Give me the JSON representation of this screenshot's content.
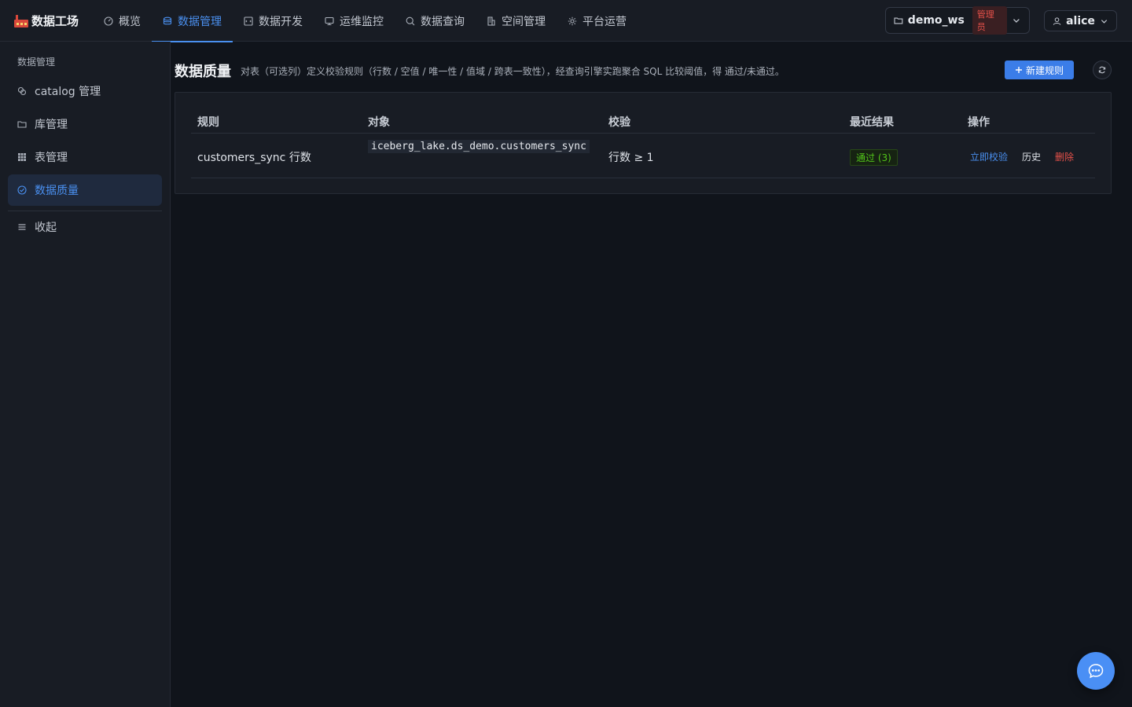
{
  "brand": {
    "title": "数据工场"
  },
  "nav": {
    "items": [
      {
        "label": "概览",
        "icon": "dashboard-icon"
      },
      {
        "label": "数据管理",
        "icon": "database-icon",
        "active": true
      },
      {
        "label": "数据开发",
        "icon": "code-icon"
      },
      {
        "label": "运维监控",
        "icon": "monitor-icon"
      },
      {
        "label": "数据查询",
        "icon": "search-icon"
      },
      {
        "label": "空间管理",
        "icon": "building-icon"
      },
      {
        "label": "平台运营",
        "icon": "gear-icon"
      }
    ]
  },
  "workspace": {
    "name": "demo_ws",
    "role": "管理员"
  },
  "user": {
    "name": "alice"
  },
  "sidebar": {
    "title": "数据管理",
    "items": [
      {
        "label": "catalog 管理",
        "icon": "link-icon"
      },
      {
        "label": "库管理",
        "icon": "folder-icon"
      },
      {
        "label": "表管理",
        "icon": "table-icon"
      },
      {
        "label": "数据质量",
        "icon": "check-circle-icon",
        "active": true
      }
    ],
    "collapse_label": "收起"
  },
  "page": {
    "title": "数据质量",
    "description": "对表（可选列）定义校验规则（行数 / 空值 / 唯一性 / 值域 / 跨表一致性），经查询引擎实跑聚合 SQL 比较阈值，得 通过/未通过。",
    "new_rule_label": "新建规则"
  },
  "table": {
    "headers": [
      "规则",
      "对象",
      "校验",
      "最近结果",
      "操作"
    ],
    "rows": [
      {
        "rule": "customers_sync 行数",
        "object": "iceberg_lake.ds_demo.customers_sync",
        "check": "行数 ≥ 1",
        "result": "通过 (3)",
        "actions": [
          "立即校验",
          "历史",
          "删除"
        ]
      }
    ]
  },
  "colors": {
    "accent": "#4a90f0",
    "pass": "#52c41a",
    "danger": "#e6514a",
    "background": "#10141b"
  }
}
